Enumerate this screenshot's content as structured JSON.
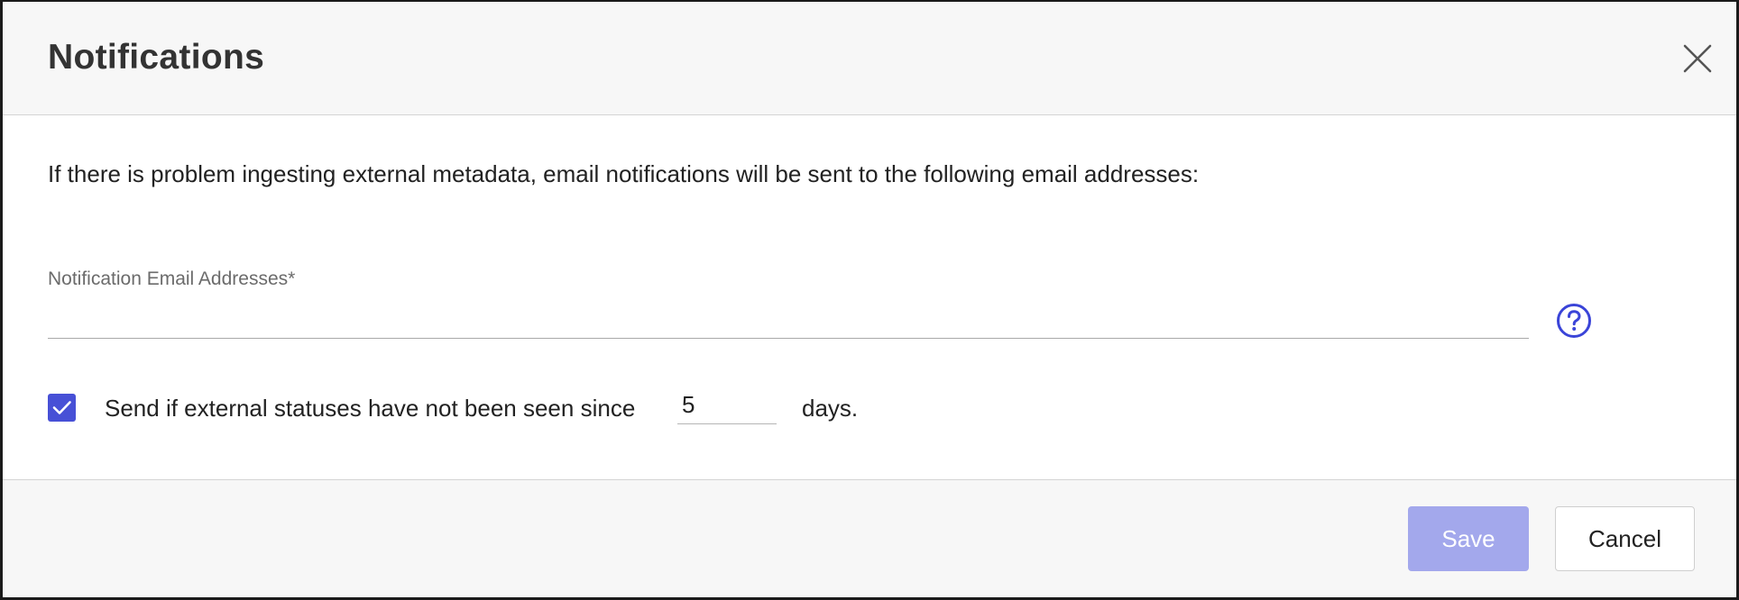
{
  "dialog": {
    "title": "Notifications",
    "close_icon": "close-icon"
  },
  "body": {
    "description": "If there is problem ingesting external metadata, email notifications will be sent to the following email addresses:",
    "email_field": {
      "label": "Notification Email Addresses*",
      "value": "",
      "placeholder": ""
    },
    "help_icon": "help-circle-icon",
    "stale_check": {
      "checked": true,
      "label_before": "Send if external statuses have not been seen since",
      "days_value": "5",
      "label_after": "days."
    }
  },
  "footer": {
    "save_label": "Save",
    "cancel_label": "Cancel"
  },
  "colors": {
    "accent": "#4750d6",
    "save_disabled": "#a3a8ec",
    "help_icon": "#3a44d8"
  }
}
